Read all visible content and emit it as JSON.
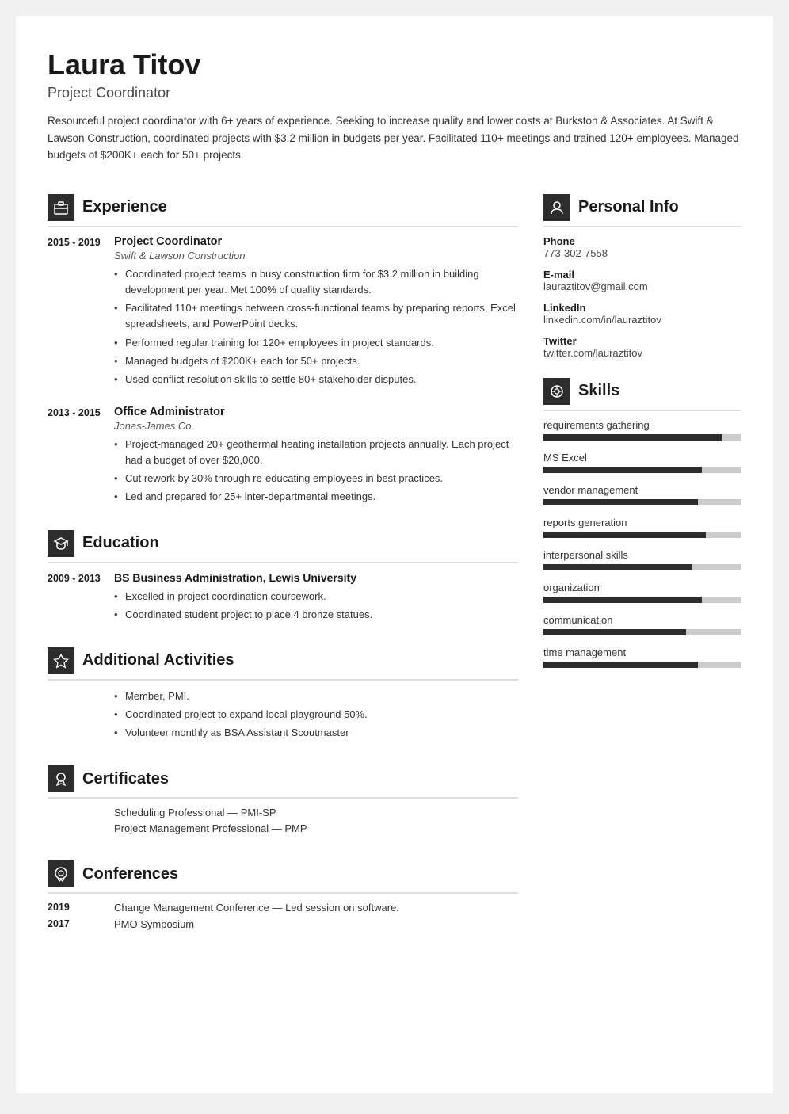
{
  "header": {
    "name": "Laura Titov",
    "title": "Project Coordinator",
    "summary": "Resourceful project coordinator with 6+ years of experience. Seeking to increase quality and lower costs at Burkston & Associates. At Swift & Lawson Construction, coordinated projects with $3.2 million in budgets per year. Facilitated 110+ meetings and trained 120+ employees. Managed budgets of $200K+ each for 50+ projects."
  },
  "sections": {
    "experience": {
      "title": "Experience",
      "jobs": [
        {
          "dates": "2015 - 2019",
          "job_title": "Project Coordinator",
          "company": "Swift & Lawson Construction",
          "bullets": [
            "Coordinated project teams in busy construction firm for $3.2 million in building development per year. Met 100% of quality standards.",
            "Facilitated 110+ meetings between cross-functional teams by preparing reports, Excel spreadsheets, and PowerPoint decks.",
            "Performed regular training for 120+ employees in project standards.",
            "Managed budgets of $200K+ each for 50+ projects.",
            "Used conflict resolution skills to settle 80+ stakeholder disputes."
          ]
        },
        {
          "dates": "2013 - 2015",
          "job_title": "Office Administrator",
          "company": "Jonas-James Co.",
          "bullets": [
            "Project-managed 20+ geothermal heating installation projects annually. Each project had a budget of over $20,000.",
            "Cut rework by 30% through re-educating employees in best practices.",
            "Led and prepared for 25+ inter-departmental meetings."
          ]
        }
      ]
    },
    "education": {
      "title": "Education",
      "entries": [
        {
          "dates": "2009 - 2013",
          "degree": "BS Business Administration, Lewis University",
          "bullets": [
            "Excelled in project coordination coursework.",
            "Coordinated student project to place 4 bronze statues."
          ]
        }
      ]
    },
    "activities": {
      "title": "Additional Activities",
      "bullets": [
        "Member, PMI.",
        "Coordinated project to expand local playground 50%.",
        "Volunteer monthly as BSA Assistant Scoutmaster"
      ]
    },
    "certificates": {
      "title": "Certificates",
      "items": [
        "Scheduling Professional — PMI-SP",
        "Project Management Professional — PMP"
      ]
    },
    "conferences": {
      "title": "Conferences",
      "entries": [
        {
          "year": "2019",
          "text": "Change Management Conference — Led session on software."
        },
        {
          "year": "2017",
          "text": "PMO Symposium"
        }
      ]
    }
  },
  "right": {
    "personal_info": {
      "title": "Personal Info",
      "items": [
        {
          "label": "Phone",
          "value": "773-302-7558"
        },
        {
          "label": "E-mail",
          "value": "lauraztitov@gmail.com"
        },
        {
          "label": "LinkedIn",
          "value": "linkedin.com/in/lauraztitov"
        },
        {
          "label": "Twitter",
          "value": "twitter.com/lauraztitov"
        }
      ]
    },
    "skills": {
      "title": "Skills",
      "items": [
        {
          "name": "requirements gathering",
          "percent": 90
        },
        {
          "name": "MS Excel",
          "percent": 80
        },
        {
          "name": "vendor management",
          "percent": 78
        },
        {
          "name": "reports generation",
          "percent": 82
        },
        {
          "name": "interpersonal skills",
          "percent": 75
        },
        {
          "name": "organization",
          "percent": 80
        },
        {
          "name": "communication",
          "percent": 72
        },
        {
          "name": "time management",
          "percent": 78
        }
      ]
    }
  },
  "icons": {
    "experience": "🗂",
    "education": "🎓",
    "activities": "⭐",
    "certificates": "🏆",
    "conferences": "💬",
    "personal_info": "👤",
    "skills": "🔧"
  }
}
